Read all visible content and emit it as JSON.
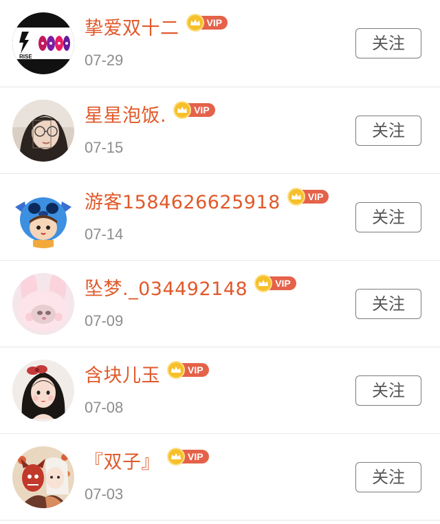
{
  "follow_list": [
    {
      "name": "挚爱双十二",
      "date": "07-29",
      "badge": "VIP",
      "button": "关注",
      "avatar_icon": "rise-logo-avatar-icon"
    },
    {
      "name": "星星泡饭.",
      "date": "07-15",
      "badge": "VIP",
      "button": "关注",
      "avatar_icon": "girl-photo-avatar-icon"
    },
    {
      "name": "游客1584626625918",
      "date": "07-14",
      "badge": "VIP",
      "button": "关注",
      "avatar_icon": "stitch-hood-avatar-icon"
    },
    {
      "name": "坠梦._034492148",
      "date": "07-09",
      "badge": "VIP",
      "button": "关注",
      "avatar_icon": "pink-bunny-avatar-icon"
    },
    {
      "name": "含块儿玉",
      "date": "07-08",
      "badge": "VIP",
      "button": "关注",
      "avatar_icon": "cartoon-girl-avatar-icon"
    },
    {
      "name": "『双子』",
      "date": "07-03",
      "badge": "VIP",
      "button": "关注",
      "avatar_icon": "anime-pair-avatar-icon"
    }
  ],
  "colors": {
    "name": "#e0592a",
    "date": "#8c8c8c",
    "vip_tag": "#e5624a",
    "vip_crown": "#f7c02a",
    "button_border": "#7a7a7a"
  }
}
